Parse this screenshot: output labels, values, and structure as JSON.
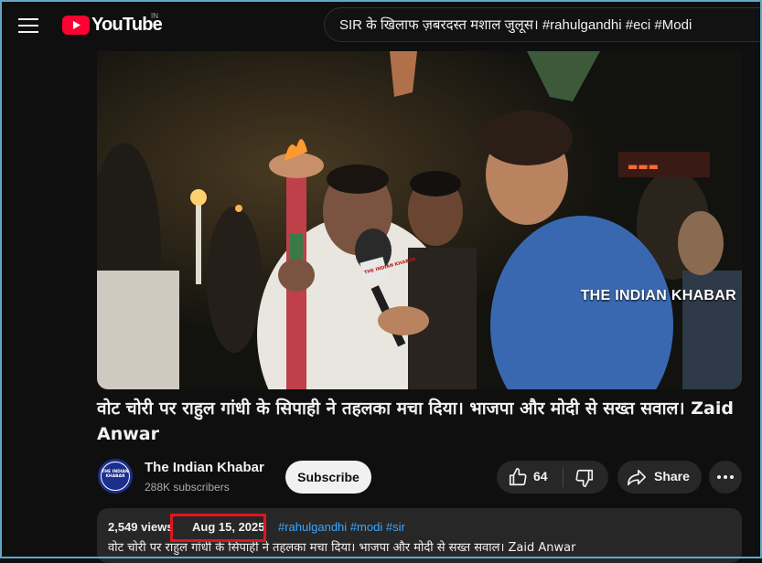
{
  "header": {
    "logo_text": "YouTube",
    "country_code": "IN",
    "search_query": "SIR के खिलाफ ज़बरदस्त मशाल जुलूस। #rahulgandhi #eci #Modi"
  },
  "video": {
    "watermark": "THE INDIAN KHABAR",
    "mic_label": "THE INDIAN KHABAR"
  },
  "title": "वोट चोरी पर राहुल गांधी के सिपाही ने तहलका मचा दिया। भाजपा और मोदी से सख्त सवाल। Zaid Anwar",
  "channel": {
    "name": "The Indian Khabar",
    "subscribers": "288K subscribers",
    "avatar_text": "THE INDIAN KHABAR",
    "subscribe_label": "Subscribe"
  },
  "actions": {
    "like_count": "64",
    "share_label": "Share"
  },
  "description": {
    "views": "2,549 views",
    "date": "Aug 15, 2025",
    "tags": [
      "#rahulgandhi",
      "#modi",
      "#sir"
    ],
    "text": "वोट चोरी पर राहुल गांधी के सिपाही ने तहलका मचा दिया। भाजपा और मोदी से सख्त सवाल। Zaid Anwar"
  },
  "icons": [
    "menu-icon",
    "youtube-logo-icon",
    "like-icon",
    "dislike-icon",
    "share-icon",
    "more-icon"
  ],
  "colors": {
    "background": "#0f0f0f",
    "brand_red": "#ff0033",
    "pill": "#272727",
    "link": "#3ea6ff",
    "highlight_box": "#e0151d"
  }
}
